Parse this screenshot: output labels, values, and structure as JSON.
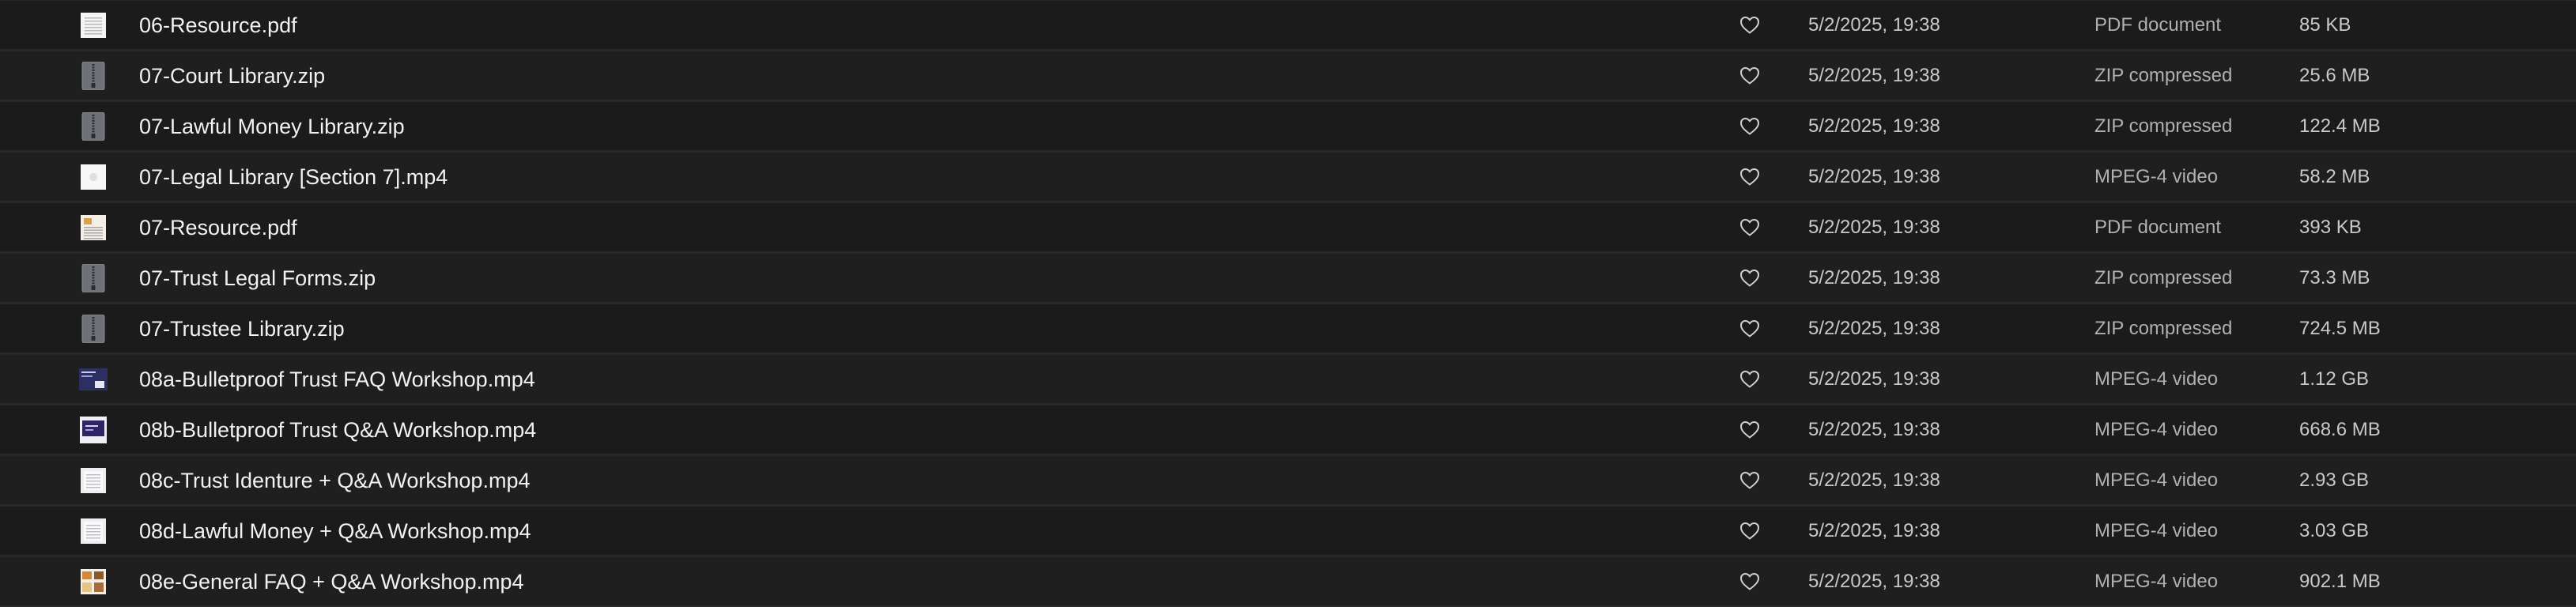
{
  "files": [
    {
      "name": "06-Resource.pdf",
      "date": "5/2/2025, 19:38",
      "kind": "PDF document",
      "size": "85 KB",
      "icon": "pdf-icon"
    },
    {
      "name": "07-Court Library.zip",
      "date": "5/2/2025, 19:38",
      "kind": "ZIP compressed",
      "size": "25.6 MB",
      "icon": "zip-icon"
    },
    {
      "name": "07-Lawful Money Library.zip",
      "date": "5/2/2025, 19:38",
      "kind": "ZIP compressed",
      "size": "122.4 MB",
      "icon": "zip-icon"
    },
    {
      "name": "07-Legal Library [Section 7].mp4",
      "date": "5/2/2025, 19:38",
      "kind": "MPEG-4 video",
      "size": "58.2 MB",
      "icon": "video-thumb-white-icon"
    },
    {
      "name": "07-Resource.pdf",
      "date": "5/2/2025, 19:38",
      "kind": "PDF document",
      "size": "393 KB",
      "icon": "pdf-color-icon"
    },
    {
      "name": "07-Trust Legal Forms.zip",
      "date": "5/2/2025, 19:38",
      "kind": "ZIP compressed",
      "size": "73.3 MB",
      "icon": "zip-icon"
    },
    {
      "name": "07-Trustee Library.zip",
      "date": "5/2/2025, 19:38",
      "kind": "ZIP compressed",
      "size": "724.5 MB",
      "icon": "zip-icon"
    },
    {
      "name": "08a-Bulletproof Trust FAQ Workshop.mp4",
      "date": "5/2/2025, 19:38",
      "kind": "MPEG-4 video",
      "size": "1.12 GB",
      "icon": "video-thumb-dark-icon"
    },
    {
      "name": "08b-Bulletproof Trust Q&A Workshop.mp4",
      "date": "5/2/2025, 19:38",
      "kind": "MPEG-4 video",
      "size": "668.6 MB",
      "icon": "video-thumb-purple-icon"
    },
    {
      "name": "08c-Trust Identure + Q&A Workshop.mp4",
      "date": "5/2/2025, 19:38",
      "kind": "MPEG-4 video",
      "size": "2.93 GB",
      "icon": "video-thumb-doc-icon"
    },
    {
      "name": "08d-Lawful Money + Q&A Workshop.mp4",
      "date": "5/2/2025, 19:38",
      "kind": "MPEG-4 video",
      "size": "3.03 GB",
      "icon": "video-thumb-doc-icon"
    },
    {
      "name": "08e-General FAQ + Q&A Workshop.mp4",
      "date": "5/2/2025, 19:38",
      "kind": "MPEG-4 video",
      "size": "902.1 MB",
      "icon": "video-thumb-color-icon"
    }
  ],
  "colors": {
    "background": "#1b1b1b",
    "row_border": "#2a2a2a",
    "name_text": "#f2f2f2",
    "meta_text": "#c9c9c9"
  }
}
